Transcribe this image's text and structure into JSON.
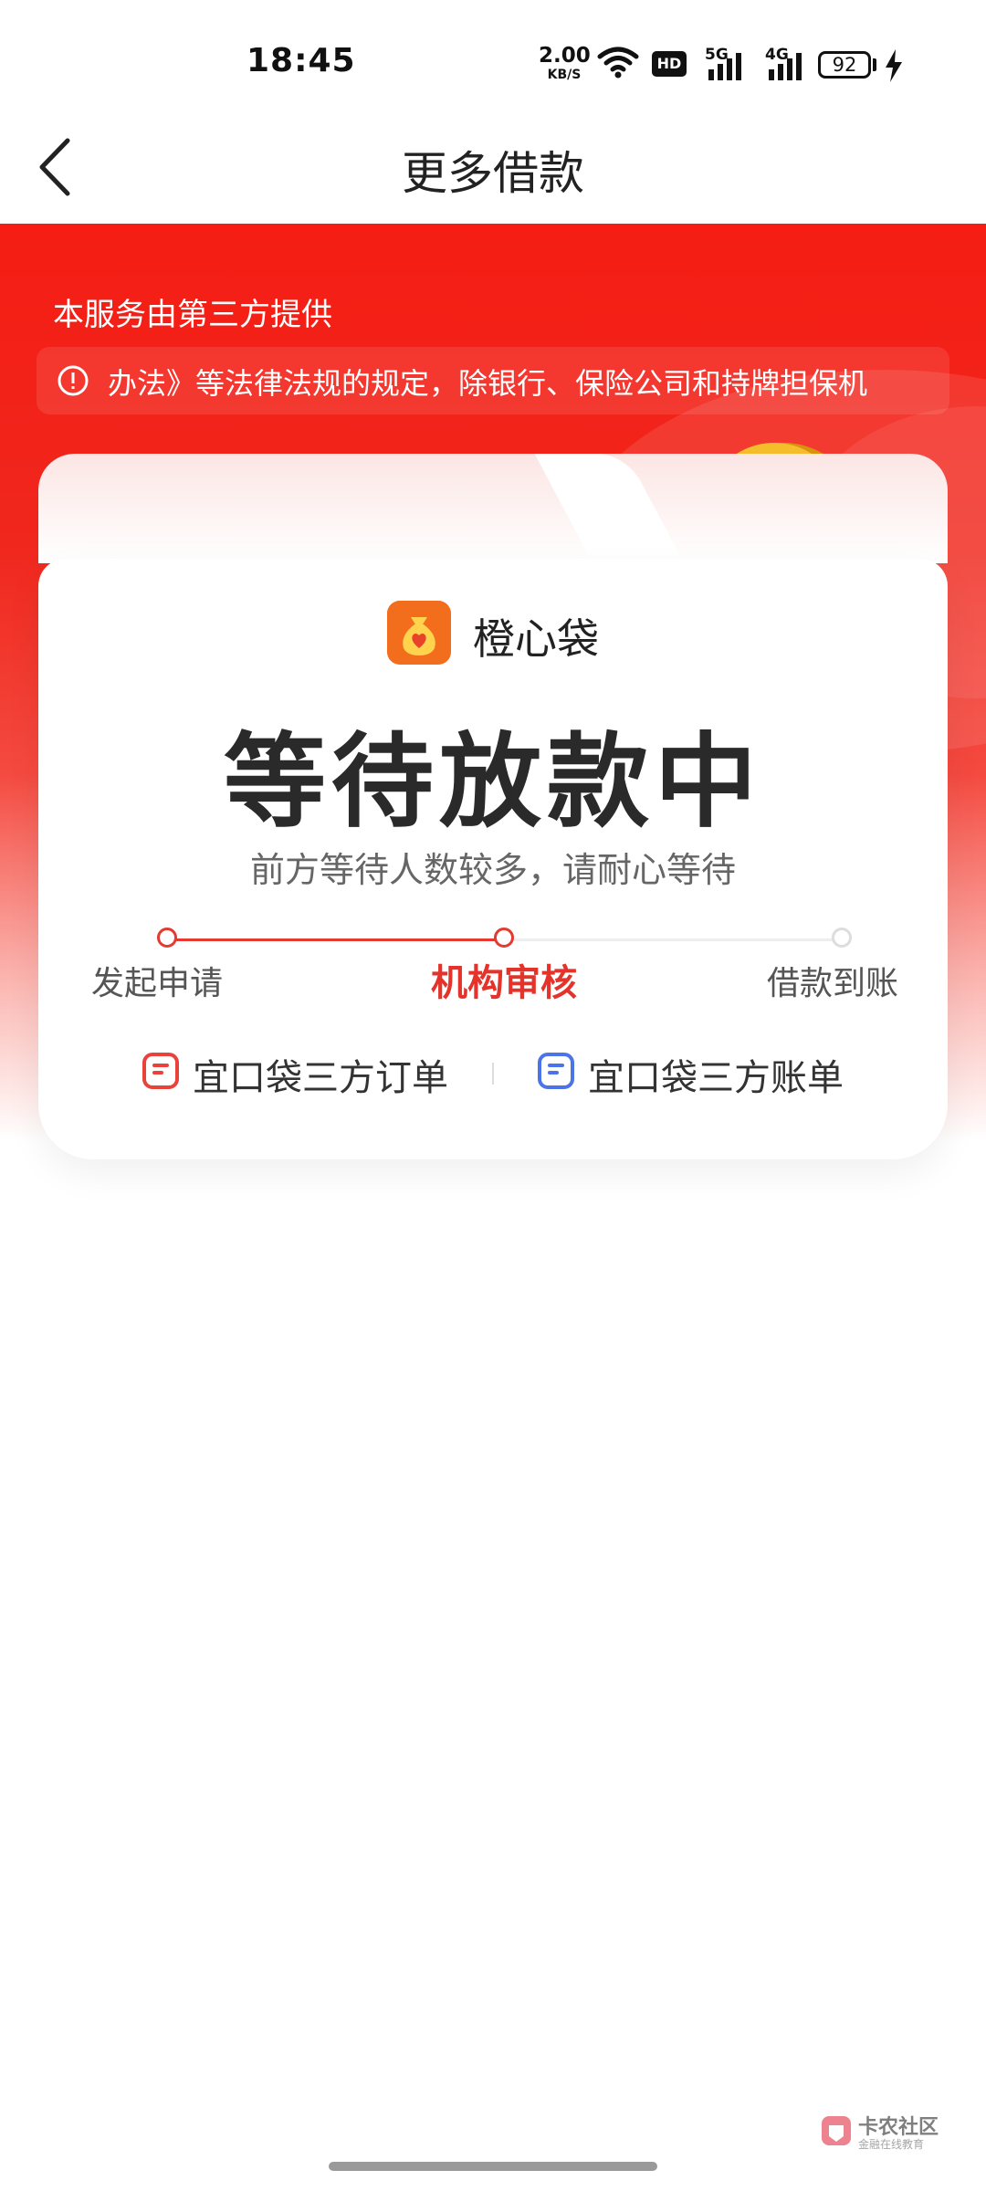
{
  "status_bar": {
    "time": "18:45",
    "net_speed_value": "2.00",
    "net_speed_unit": "KB/S",
    "hd_label": "HD",
    "net1_label": "5G",
    "net2_label": "4G",
    "battery": "92"
  },
  "nav": {
    "title": "更多借款",
    "back_icon": "chevron-left-icon"
  },
  "hero": {
    "provider_note": "本服务由第三方提供",
    "notice_text": "办法》等法律法规的规定，除银行、保险公司和持牌担保机",
    "notice_icon": "alert-circle-icon"
  },
  "card": {
    "lender_name": "橙心袋",
    "status_title": "等待放款中",
    "status_subtitle": "前方等待人数较多，请耐心等待",
    "steps": [
      {
        "label": "发起申请",
        "state": "done"
      },
      {
        "label": "机构审核",
        "state": "active"
      },
      {
        "label": "借款到账",
        "state": "pending"
      }
    ],
    "links": [
      {
        "label": "宜口袋三方订单",
        "icon": "order-doc-icon",
        "color": "#e8423a"
      },
      {
        "label": "宜口袋三方账单",
        "icon": "bill-doc-icon",
        "color": "#4a74e8"
      }
    ]
  },
  "watermark": {
    "title": "卡农社区",
    "subtitle": "金融在线教育"
  },
  "colors": {
    "brand_red": "#f51d14",
    "active_step": "#e4332b",
    "lender_logo": "#f26d1c"
  }
}
